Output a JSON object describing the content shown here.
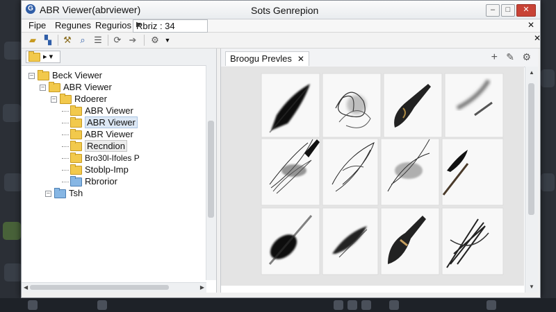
{
  "window": {
    "app_title": "ABR Viewer(abrviewer)",
    "subtitle": "Sots Genrepion",
    "logo_letter": "G"
  },
  "menubar": {
    "items": [
      "Fipe",
      "Regunes",
      "Regurios",
      "Rbriz : 34"
    ]
  },
  "toolbar": {
    "icons": [
      "open-folder-icon",
      "layout-icon",
      "tools-icon",
      "search-icon",
      "list-icon",
      "refresh-icon",
      "forward-icon",
      "settings-icon"
    ]
  },
  "left_pane": {
    "header_button": "▸ ▾",
    "tree": [
      {
        "label": "Beck Viewer",
        "level": 0,
        "type": "folder"
      },
      {
        "label": "ABR Viewer",
        "level": 1,
        "type": "folder"
      },
      {
        "label": "Rdoerer",
        "level": 2,
        "type": "folder"
      },
      {
        "label": "ABR Viewer",
        "level": 3,
        "type": "folder"
      },
      {
        "label": "ABR Viewer",
        "level": 3,
        "type": "folder",
        "selected": true
      },
      {
        "label": "ABR Viewer",
        "level": 3,
        "type": "folder"
      },
      {
        "label": "Recndion",
        "level": 3,
        "type": "folder",
        "selected": true
      },
      {
        "label": "Bro30l-Ifoles P",
        "level": 3,
        "type": "folder"
      },
      {
        "label": "Stoblp-Imp",
        "level": 3,
        "type": "folder"
      },
      {
        "label": "Rbrorior",
        "level": 3,
        "type": "folder-blue"
      },
      {
        "label": "Tsh",
        "level": 2,
        "type": "folder-blue"
      }
    ]
  },
  "right_pane": {
    "tab_label": "Broogu Prevles",
    "toolbar_icons": [
      "plus-icon",
      "brush-icon",
      "settings-icon",
      "close-icon"
    ]
  },
  "colors": {
    "folder_yellow": "#f2c94c",
    "folder_blue": "#86b6e4",
    "selection": "#dde8f5",
    "close_red": "#c84336"
  }
}
